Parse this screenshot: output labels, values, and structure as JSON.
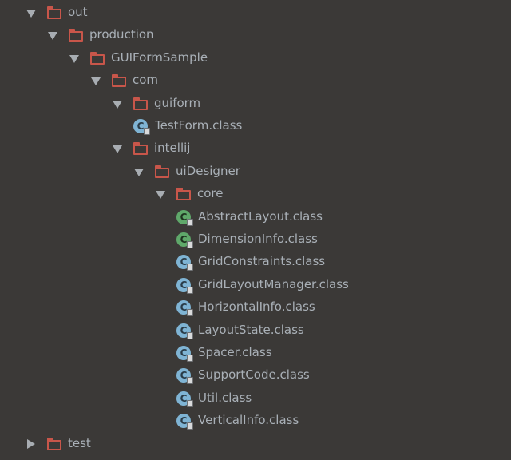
{
  "tree": [
    {
      "label": "out",
      "kind": "folder",
      "expanded": true
    },
    {
      "label": "production",
      "kind": "folder",
      "expanded": true
    },
    {
      "label": "GUIFormSample",
      "kind": "folder",
      "expanded": true
    },
    {
      "label": "com",
      "kind": "folder",
      "expanded": true
    },
    {
      "label": "guiform",
      "kind": "folder",
      "expanded": true
    },
    {
      "label": "TestForm.class",
      "kind": "class"
    },
    {
      "label": "intellij",
      "kind": "folder",
      "expanded": true
    },
    {
      "label": "uiDesigner",
      "kind": "folder",
      "expanded": true
    },
    {
      "label": "core",
      "kind": "folder",
      "expanded": true
    },
    {
      "label": "AbstractLayout.class",
      "kind": "abstract-class"
    },
    {
      "label": "DimensionInfo.class",
      "kind": "abstract-class"
    },
    {
      "label": "GridConstraints.class",
      "kind": "class"
    },
    {
      "label": "GridLayoutManager.class",
      "kind": "class"
    },
    {
      "label": "HorizontalInfo.class",
      "kind": "class"
    },
    {
      "label": "LayoutState.class",
      "kind": "class"
    },
    {
      "label": "Spacer.class",
      "kind": "class"
    },
    {
      "label": "SupportCode.class",
      "kind": "class"
    },
    {
      "label": "Util.class",
      "kind": "class"
    },
    {
      "label": "VerticalInfo.class",
      "kind": "class"
    },
    {
      "label": "test",
      "kind": "folder",
      "expanded": false
    }
  ],
  "icons": {
    "folder": "folder-icon",
    "class": "class-file-icon",
    "abstract-class": "abstract-class-file-icon",
    "expanded": "chevron-down-icon",
    "collapsed": "chevron-right-icon"
  },
  "colors": {
    "background": "#3b3937",
    "text": "#a9b0b7",
    "folder": "#c8564a",
    "class": "#7fb4d4",
    "abstract-class": "#5fa86a"
  }
}
